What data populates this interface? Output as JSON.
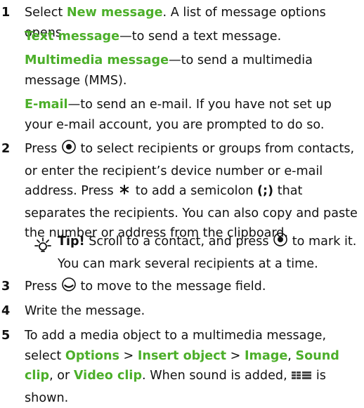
{
  "step1": {
    "num": "1",
    "pre": "Select ",
    "link": "New message",
    "post": ". A list of message options opens.",
    "options": [
      {
        "name": "Text message",
        "desc": "—to send a text message."
      },
      {
        "name": "Multimedia message",
        "desc": "—to send a multimedia message (MMS)."
      },
      {
        "name": "E-mail",
        "desc": "—to send an e-mail. If you have not set up your e-mail account, you are prompted to do so."
      }
    ]
  },
  "step2": {
    "num": "2",
    "t1": "Press ",
    "t2": " to select recipients or groups from contacts, or enter the recipient’s device number or e-mail address. Press ",
    "t3": " to add a semicolon ",
    "semicolon": "(;)",
    "t4": " that separates the recipients. You can also copy and paste the number or address from the clipboard.",
    "tip_label": "Tip!",
    "tip_t1": " Scroll to a contact, and press ",
    "tip_t2": " to mark it. You can mark several recipients at a time."
  },
  "step3": {
    "num": "3",
    "t1": "Press ",
    "t2": " to move to the message field."
  },
  "step4": {
    "num": "4",
    "text": "Write the message."
  },
  "step5": {
    "num": "5",
    "t1": "To add a media object to a multimedia message, select ",
    "options": "Options",
    "sep1": " > ",
    "insert": "Insert object",
    "sep2": " > ",
    "image": "Image",
    "comma": ", ",
    "sound": "Sound clip",
    "t2": ",",
    "or": " or ",
    "video": "Video clip",
    "t3": ". When sound is added, ",
    "t4": " is shown."
  },
  "icons": {
    "select": "select-key-icon",
    "asterisk": "asterisk-key-icon",
    "scroll_down": "scroll-down-key-icon",
    "tip": "tip-sun-icon",
    "sound": "sound-indicator-icon"
  },
  "colors": {
    "accent": "#4caf2a",
    "text": "#111111"
  }
}
